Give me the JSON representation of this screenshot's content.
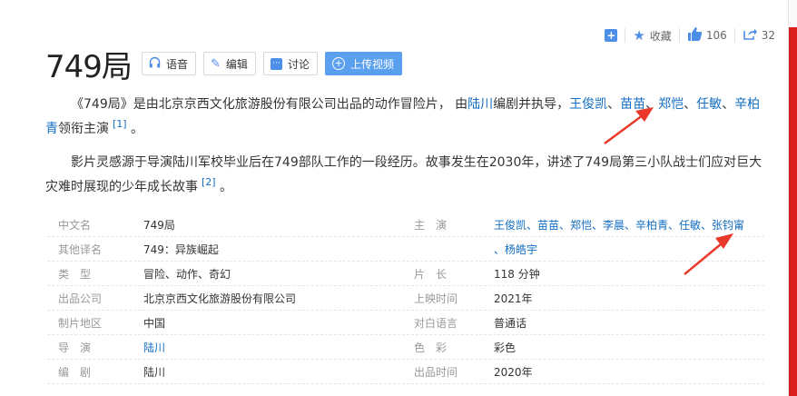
{
  "header": {
    "title": "749局",
    "actions": [
      {
        "label": "",
        "icon": "add-box-icon"
      },
      {
        "label": "收藏",
        "icon": "star-icon"
      },
      {
        "label": "106",
        "icon": "thumbs-up-icon"
      },
      {
        "label": "32",
        "icon": "share-icon"
      }
    ],
    "buttons": {
      "voice": "语音",
      "edit": "编辑",
      "discuss": "讨论",
      "upload": "上传视频"
    }
  },
  "intro": {
    "p1_a": "《749局》是由北京京西文化旅游股份有限公司出品的动作冒险片，  由",
    "p1_director": "陆川",
    "p1_b": "编剧并执导，",
    "p1_actors": [
      "王俊凯",
      "苗苗",
      "郑恺",
      "任敏",
      "辛柏青"
    ],
    "sep": "、",
    "p1_c": "领衔主演",
    "ref1": "[1]",
    "dot": "。",
    "p2": "影片灵感源于导演陆川军校毕业后在749部队工作的一段经历。故事发生在2030年，讲述了749局第三小队战士们应对巨大灾难时展现的少年成长故事",
    "ref2": "[2]"
  },
  "info": {
    "left": [
      {
        "key": "中文名",
        "value": "749局"
      },
      {
        "key": "其他译名",
        "value": "749：异族崛起"
      },
      {
        "key": "类　型",
        "value": "冒险、动作、奇幻"
      },
      {
        "key": "出品公司",
        "value": "北京京西文化旅游股份有限公司"
      },
      {
        "key": "制片地区",
        "value": "中国"
      },
      {
        "key": "导　演",
        "value": "陆川"
      },
      {
        "key": "编　剧",
        "value": "陆川"
      }
    ],
    "right": [
      {
        "key": "主　演",
        "value": "王俊凯、苗苗、郑恺、李晨、辛柏青、任敏、张钧甯"
      },
      {
        "key": "",
        "value": "、杨皓宇"
      },
      {
        "key": "片　长",
        "value": "118 分钟"
      },
      {
        "key": "上映时间",
        "value": "2021年"
      },
      {
        "key": "对白语言",
        "value": "普通话"
      },
      {
        "key": "色　彩",
        "value": "彩色"
      },
      {
        "key": "出品时间",
        "value": "2020年"
      }
    ]
  },
  "colors": {
    "link": "#136ec2",
    "accent": "#4d8ee8",
    "arrow": "#e8392a"
  }
}
